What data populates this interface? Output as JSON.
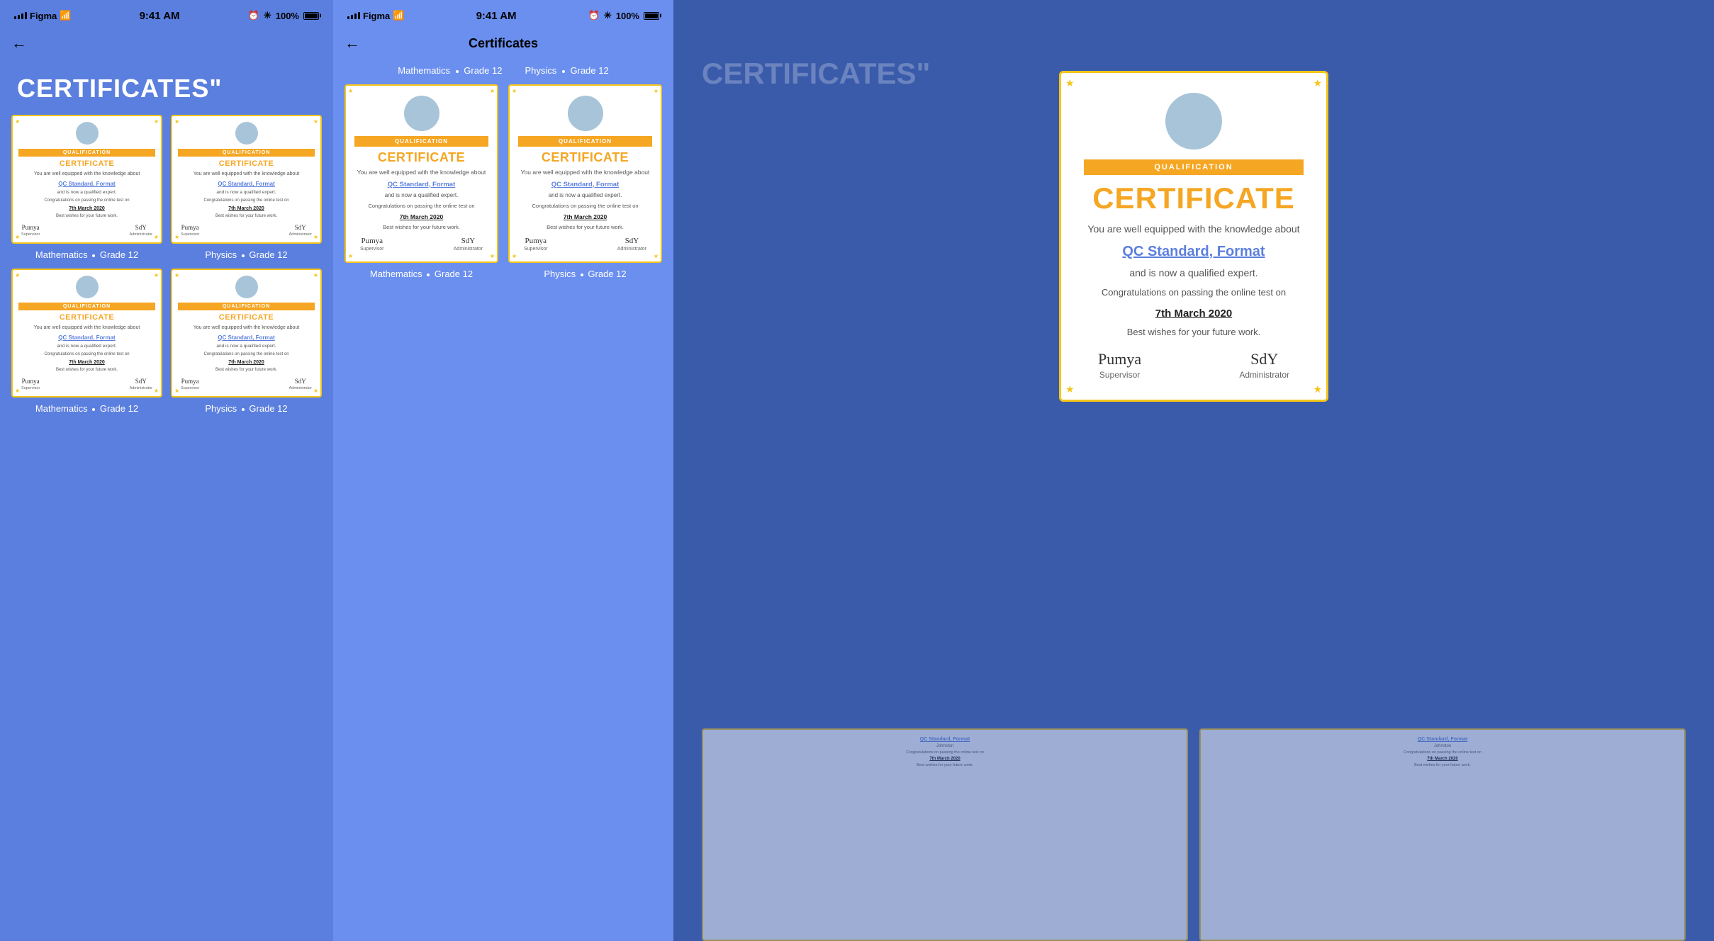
{
  "app": {
    "name": "Figma",
    "time": "9:41 AM",
    "battery": "100%",
    "signal": "full"
  },
  "panel1": {
    "status_bar": {
      "carrier": "Figma",
      "wifi": true,
      "time": "9:41 AM",
      "battery": "100%"
    },
    "heading": "CERTIFICATES\"",
    "back_arrow": "←",
    "certificates": [
      {
        "subject": "Mathematics",
        "grade": "Grade 12",
        "qualification_label": "QUALIFICATION",
        "title": "CERTIFICATE",
        "body": "You are well equipped with the knowledge about",
        "subject_link": "QC Standard, Format",
        "qualified": "and is now a qualified expert.",
        "congrats": "Congratulations on passing the online test on",
        "date": "7th March 2020",
        "best_wishes": "Best wishes for your future work.",
        "supervisor": "Supervisor",
        "administrator": "Administrator"
      },
      {
        "subject": "Physics",
        "grade": "Grade 12",
        "qualification_label": "QUALIFICATION",
        "title": "CERTIFICATE",
        "body": "You are well equipped with the knowledge about",
        "subject_link": "QC Standard, Format",
        "qualified": "and is now a qualified expert.",
        "congrats": "Congratulations on passing the online test on",
        "date": "7th March 2020",
        "best_wishes": "Best wishes for your future work.",
        "supervisor": "Supervisor",
        "administrator": "Administrator"
      },
      {
        "subject": "Mathematics",
        "grade": "Grade 12",
        "qualification_label": "QUALIFICATION",
        "title": "CERTIFICATE",
        "body": "You are well equipped with the knowledge about",
        "subject_link": "QC Standard, Format",
        "qualified": "and is now a qualified expert.",
        "congrats": "Congratulations on passing the online test on",
        "date": "7th March 2020",
        "best_wishes": "Best wishes for your future work.",
        "supervisor": "Supervisor",
        "administrator": "Administrator"
      },
      {
        "subject": "Physics",
        "grade": "Grade 12",
        "qualification_label": "QUALIFICATION",
        "title": "CERTIFICATE",
        "body": "You are well equipped with the knowledge about",
        "subject_link": "QC Standard, Format",
        "qualified": "and is now a qualified expert.",
        "congrats": "Congratulations on passing the online test on",
        "date": "7th March 2020",
        "best_wishes": "Best wishes for your future work.",
        "supervisor": "Supervisor",
        "administrator": "Administrator"
      }
    ]
  },
  "panel2": {
    "status_bar": {
      "carrier": "Figma",
      "wifi": true,
      "time": "9:41 AM",
      "battery": "100%"
    },
    "nav_title": "Certificates",
    "back_arrow": "←",
    "filter_tabs": [
      {
        "subject": "Mathematics",
        "grade": "Grade 12"
      },
      {
        "subject": "Physics",
        "grade": "Grade 12"
      }
    ],
    "certificates": [
      {
        "subject": "Mathematics",
        "grade": "Grade 12",
        "qualification_label": "QUALIFICATION",
        "title": "CERTIFICATE",
        "body": "You are well equipped with the knowledge about",
        "subject_link": "QC Standard, Format",
        "qualified": "and is now a qualified expert.",
        "congrats": "Congratulations on passing the online test on",
        "date": "7th March 2020",
        "best_wishes": "Best wishes for your future work.",
        "supervisor": "Supervisor",
        "administrator": "Administrator"
      },
      {
        "subject": "Physics",
        "grade": "Grade 12",
        "qualification_label": "QUALIFICATION",
        "title": "CERTIFICATE",
        "body": "You are well equipped with the knowledge about",
        "subject_link": "QC Standard, Format",
        "qualified": "and is now a qualified expert.",
        "congrats": "Congratulations on passing the online test on",
        "date": "7th March 2020",
        "best_wishes": "Best wishes for your future work.",
        "supervisor": "Supervisor",
        "administrator": "Administrator"
      }
    ]
  },
  "panel3": {
    "heading": "CERTIFICATES\"",
    "big_cert": {
      "qualification_label": "QUALIFICATION",
      "title": "CERTIFICATE",
      "body": "You are well equipped with the knowledge about",
      "subject_link": "QC Standard, Format",
      "qualified": "and is now a qualified expert.",
      "congrats": "Congratulations on passing the online test on",
      "date": "7th March 2020",
      "best_wishes": "Best wishes for your future work.",
      "supervisor": "Supervisor",
      "administrator": "Administrator"
    },
    "bg_certs": [
      {
        "subject_link": "QC Standard, Format",
        "name": "Johnston",
        "congrats": "Congratulations on passing the online test on",
        "date": "7th March 2020",
        "best_wishes": "Best wishes for your future work."
      },
      {
        "subject_link": "QC Standard, Format",
        "name": "Johnston",
        "congrats": "Congratulations on passing the online test on",
        "date": "7th March 2020",
        "best_wishes": "Best wishes for your future work."
      }
    ]
  }
}
